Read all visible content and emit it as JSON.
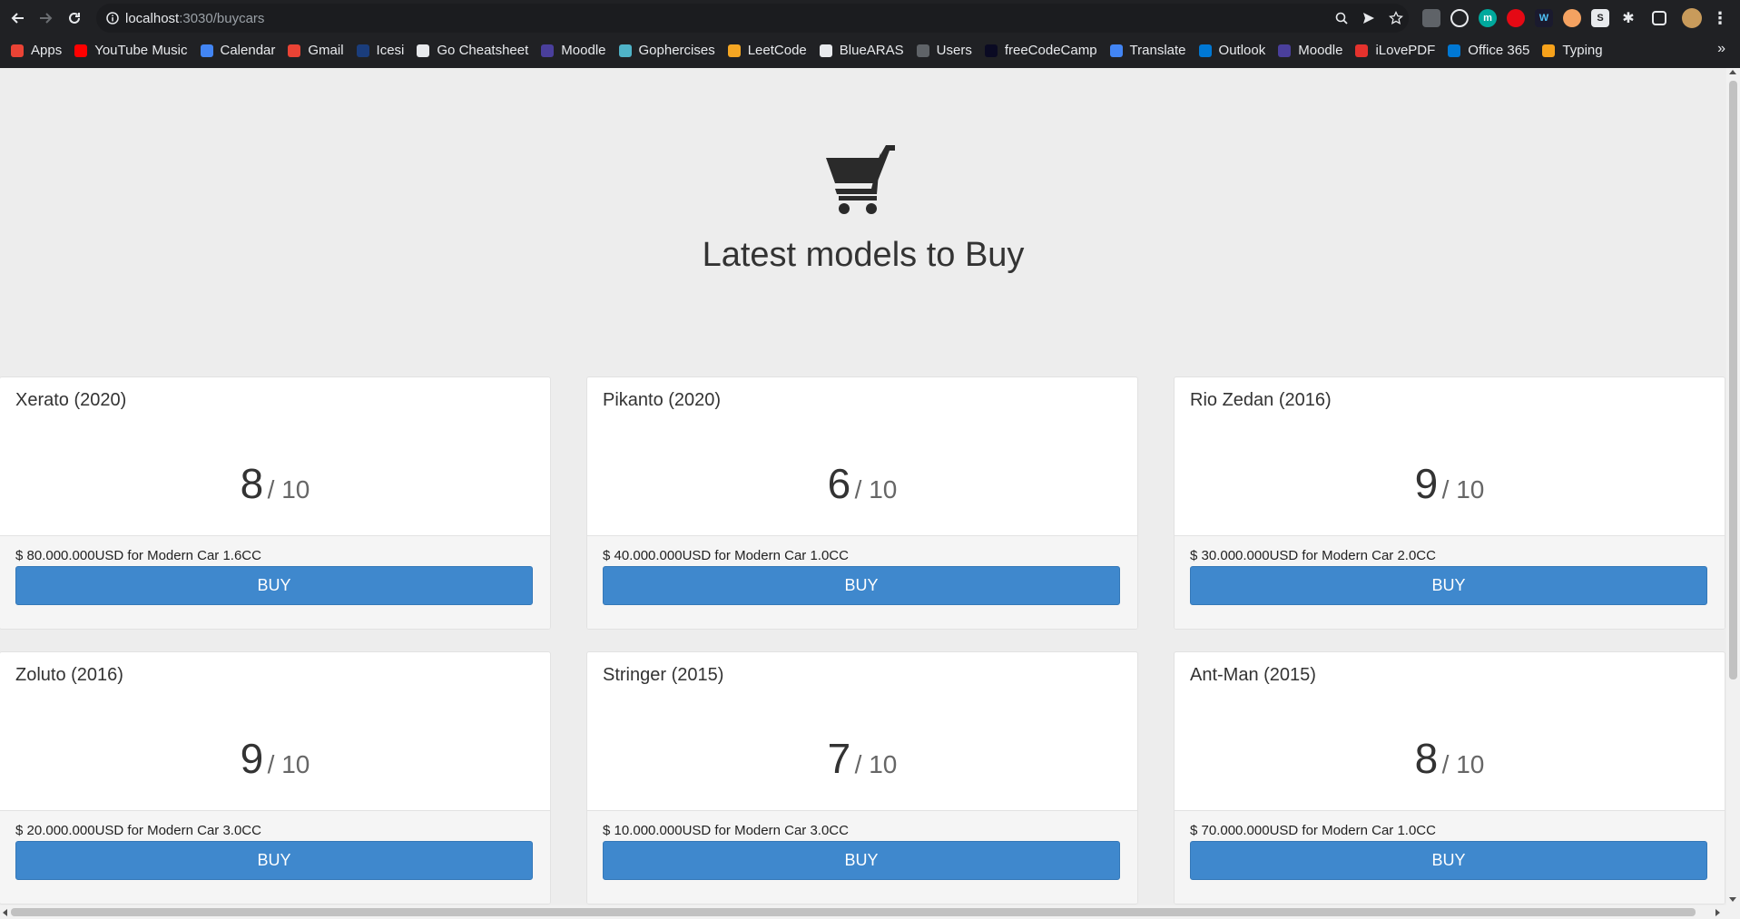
{
  "browser": {
    "url_host": "localhost",
    "url_rest": ":3030/buycars",
    "bookmarks": [
      {
        "label": "Apps",
        "icon": "apps-grid-icon",
        "color": "#ea4335"
      },
      {
        "label": "YouTube Music",
        "icon": "youtube-music-icon",
        "color": "#ff0000"
      },
      {
        "label": "Calendar",
        "icon": "calendar-icon",
        "color": "#4285f4"
      },
      {
        "label": "Gmail",
        "icon": "gmail-icon",
        "color": "#ea4335"
      },
      {
        "label": "Icesi",
        "icon": "icesi-icon",
        "color": "#1a3d7c"
      },
      {
        "label": "Go Cheatsheet",
        "icon": "github-icon",
        "color": "#e8eaed"
      },
      {
        "label": "Moodle",
        "icon": "moodle-icon",
        "color": "#4a3f9c"
      },
      {
        "label": "Gophercises",
        "icon": "gophercises-icon",
        "color": "#4fb3c8"
      },
      {
        "label": "LeetCode",
        "icon": "leetcode-icon",
        "color": "#f5a623"
      },
      {
        "label": "BlueARAS",
        "icon": "bluearas-icon",
        "color": "#e8eaed"
      },
      {
        "label": "Users",
        "icon": "users-icon",
        "color": "#5f6368"
      },
      {
        "label": "freeCodeCamp",
        "icon": "freecodecamp-icon",
        "color": "#0a0a23"
      },
      {
        "label": "Translate",
        "icon": "translate-icon",
        "color": "#4285f4"
      },
      {
        "label": "Outlook",
        "icon": "outlook-icon",
        "color": "#0078d4"
      },
      {
        "label": "Moodle",
        "icon": "moodle-icon",
        "color": "#4a3f9c"
      },
      {
        "label": "iLovePDF",
        "icon": "ilovepdf-icon",
        "color": "#e5322d"
      },
      {
        "label": "Office 365",
        "icon": "office-icon",
        "color": "#0078d4"
      },
      {
        "label": "Typing",
        "icon": "typing-icon",
        "color": "#f7a21b"
      }
    ],
    "bookmarks_more": "»"
  },
  "hero": {
    "icon": "shopping-cart-icon",
    "title": "Latest models to Buy"
  },
  "cars": [
    {
      "name": "Xerato (2020)",
      "score": "8",
      "outof": "/ 10",
      "desc": "$ 80.000.000USD for Modern Car 1.6CC",
      "button": "BUY"
    },
    {
      "name": "Pikanto (2020)",
      "score": "6",
      "outof": "/ 10",
      "desc": "$ 40.000.000USD for Modern Car 1.0CC",
      "button": "BUY"
    },
    {
      "name": "Rio Zedan (2016)",
      "score": "9",
      "outof": "/ 10",
      "desc": "$ 30.000.000USD for Modern Car 2.0CC",
      "button": "BUY"
    },
    {
      "name": "Zoluto (2016)",
      "score": "9",
      "outof": "/ 10",
      "desc": "$ 20.000.000USD for Modern Car 3.0CC",
      "button": "BUY"
    },
    {
      "name": "Stringer (2015)",
      "score": "7",
      "outof": "/ 10",
      "desc": "$ 10.000.000USD for Modern Car 3.0CC",
      "button": "BUY"
    },
    {
      "name": "Ant-Man (2015)",
      "score": "8",
      "outof": "/ 10",
      "desc": "$ 70.000.000USD for Modern Car 1.0CC",
      "button": "BUY"
    }
  ],
  "colors": {
    "button": "#3f88cd",
    "background": "#ededed",
    "chrome": "#202124"
  }
}
